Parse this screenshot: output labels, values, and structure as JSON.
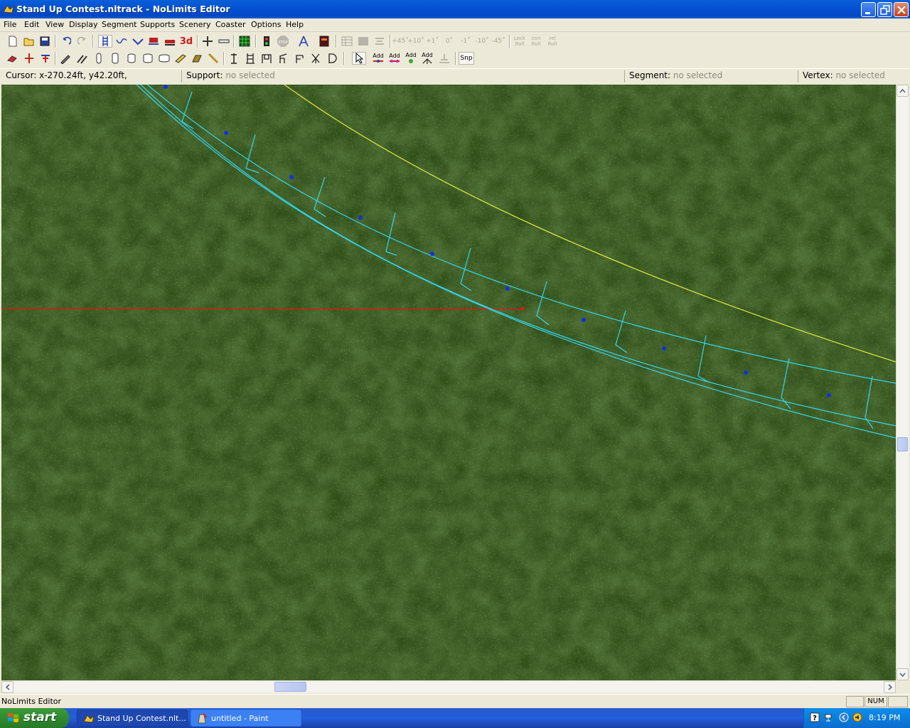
{
  "window": {
    "title": "Stand Up Contest.nltrack - NoLimits Editor"
  },
  "menu": [
    "File",
    "Edit",
    "View",
    "Display",
    "Segment",
    "Supports",
    "Scenery",
    "Coaster",
    "Options",
    "Help"
  ],
  "toolbar1": {
    "three_d_label": "3d",
    "stop_label": "STOP",
    "angles": [
      "+45˚",
      "+10˚",
      "+1˚",
      "0˚",
      "-1˚",
      "-10˚",
      "-45˚"
    ],
    "lock_roll": "Lock Roll",
    "con_roll": "con Roll",
    "rel_roll": "rel Roll"
  },
  "toolbar2": {
    "add_labels": [
      "Add",
      "Add",
      "Add",
      "Add"
    ],
    "snap_label": "Snp"
  },
  "status": {
    "cursor_label": "Cursor:",
    "cursor_value": "x-270.24ft, y42.20ft,",
    "support_label": "Support:",
    "support_value": "no selected",
    "segment_label": "Segment:",
    "segment_value": "no selected",
    "vertex_label": "Vertex:",
    "vertex_value": "no selected"
  },
  "app_status": {
    "text": "NoLimits Editor",
    "num": "NUM"
  },
  "taskbar": {
    "start": "start",
    "tasks": [
      "Stand Up Contest.nlt...",
      "untitled - Paint"
    ],
    "clock": "8:19 PM"
  },
  "colors": {
    "track": "#33d6f0",
    "guide": "#e4ec40",
    "cursor_line": "#ee1111",
    "node": "#1030e0",
    "ground": "#2d4a17"
  }
}
